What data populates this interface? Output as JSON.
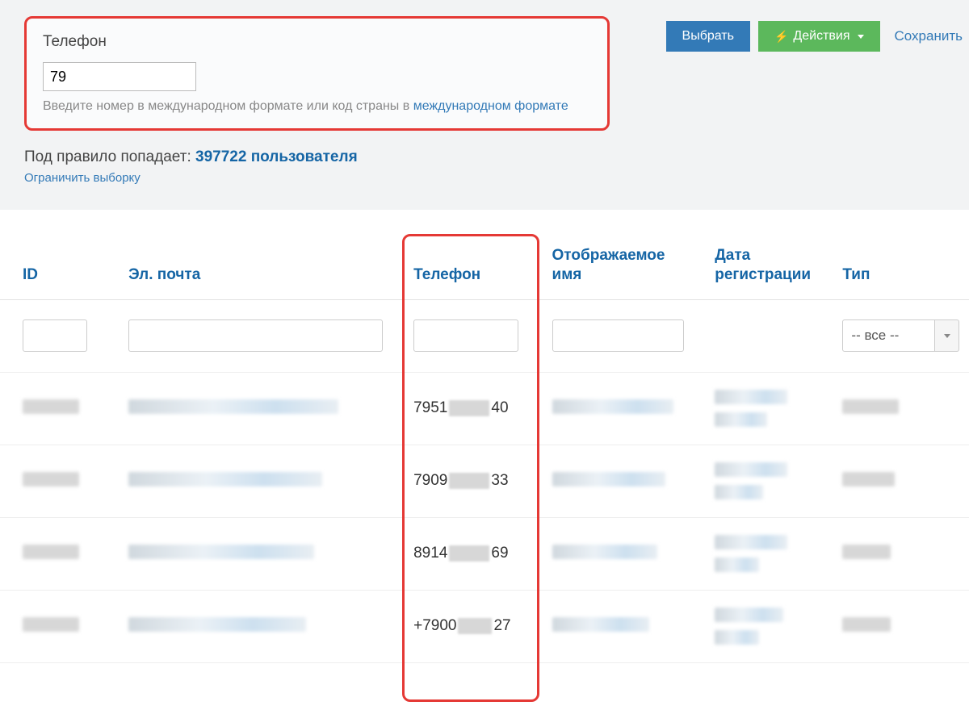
{
  "actions": {
    "select_label": "Выбрать",
    "actions_label": "Действия",
    "save_label": "Сохранить"
  },
  "phone_filter": {
    "label": "Телефон",
    "value": "79",
    "hint_prefix": "Введите номер в международном формате или код страны в ",
    "hint_link": "международном формате"
  },
  "rule_match": {
    "prefix": "Под правило попадает: ",
    "count_users": "397722 пользователя",
    "limit_link": "Ограничить выборку"
  },
  "table": {
    "headers": {
      "id": "ID",
      "email": "Эл. почта",
      "phone": "Телефон",
      "display_name": "Отображаемое имя",
      "reg_date": "Дата регистрации",
      "type": "Тип"
    },
    "type_filter_label": "-- все --",
    "rows": [
      {
        "phone_prefix": "7951",
        "phone_suffix": "40"
      },
      {
        "phone_prefix": "7909",
        "phone_suffix": "33"
      },
      {
        "phone_prefix": "8914",
        "phone_suffix": "69"
      },
      {
        "phone_prefix": "+7900",
        "phone_suffix": "27"
      }
    ]
  }
}
